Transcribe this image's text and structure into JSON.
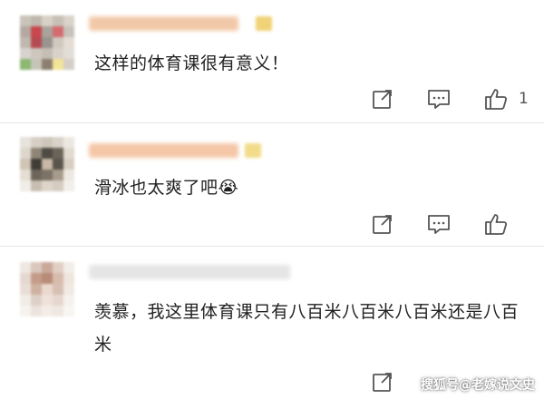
{
  "comments": [
    {
      "text": "这样的体育课很有意义！",
      "like_count": "1",
      "username_blurred": true,
      "avatar_colors": [
        "#c9c3b9",
        "#bfb8ad",
        "#d8d1c7",
        "#c7c0b6",
        "#d9d3cb",
        "#b3a9a0",
        "#c9474d",
        "#a9a39c",
        "#d46b70",
        "#c8c2bb",
        "#c0b8ae",
        "#b54b52",
        "#9a948f",
        "#cfc8bf",
        "#e3ddd5",
        "#d8d3ce",
        "#cec7bf",
        "#c5beb5",
        "#d8d2ca",
        "#e2ddd6",
        "#8cb873",
        "#c6c4b8",
        "#8c7f6f",
        "#f2e598",
        "#d5cfc7"
      ],
      "username_color": "#f2c9a8",
      "badge_color": "#f1d277"
    },
    {
      "text": "滑冰也太爽了吧😭",
      "like_count": "",
      "username_blurred": true,
      "avatar_colors": [
        "#e7e2dc",
        "#d6cfc6",
        "#cfc6bb",
        "#d9d2c9",
        "#ece7e1",
        "#ded7cc",
        "#8f8576",
        "#4e4a44",
        "#6b6459",
        "#e1dad0",
        "#cfc4b5",
        "#3f3b36",
        "#c7b9a6",
        "#5a544c",
        "#d8cfc3",
        "#e5ded4",
        "#6e665b",
        "#7b7366",
        "#a79b8c",
        "#ede8e2",
        "#f0ece7",
        "#c8beb1",
        "#ddd5ca",
        "#d5cdc2",
        "#f2eee9"
      ],
      "username_color": "#f4c7a6",
      "badge_color": "#f2dc8a"
    },
    {
      "text": "羡慕，我这里体育课只有八百米八百米八百米还是八百米",
      "like_count": "",
      "username_blurred": true,
      "avatar_colors": [
        "#efe7e1",
        "#d9c7bc",
        "#caa99a",
        "#e1cfc4",
        "#f3ede8",
        "#e5d8cf",
        "#c49b88",
        "#b88c79",
        "#d7bcae",
        "#efe6df",
        "#e9ded6",
        "#cfb1a2",
        "#ead9cf",
        "#d7c0b3",
        "#f1e9e3",
        "#f2ece7",
        "#ded0c7",
        "#efe2da",
        "#e6d8cf",
        "#f6f1ed",
        "#f6f2ee",
        "#ece3dd",
        "#f3ece7",
        "#efe7e1",
        "#f8f5f2"
      ],
      "username_color": "#e5e5e5",
      "badge_color": "#ffffff"
    }
  ],
  "icons": {
    "share": "share-icon",
    "reply": "reply-icon",
    "like": "thumbs-up-icon"
  },
  "watermark": "搜狐号@老嫁说文史"
}
